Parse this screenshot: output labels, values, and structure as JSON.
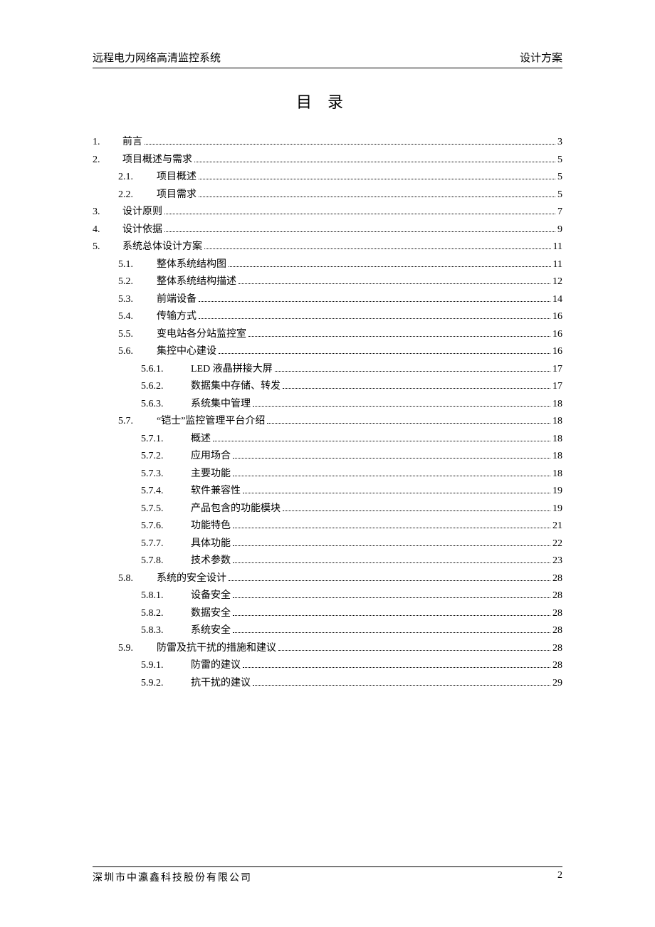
{
  "header": {
    "left": "远程电力网络高清监控系统",
    "right": "设计方案"
  },
  "title": "目录",
  "toc": [
    {
      "lvl": 1,
      "num": "1.",
      "label": "前言",
      "page": "3"
    },
    {
      "lvl": 1,
      "num": "2.",
      "label": "项目概述与需求",
      "page": "5"
    },
    {
      "lvl": 2,
      "num": "2.1.",
      "label": "项目概述",
      "page": "5"
    },
    {
      "lvl": 2,
      "num": "2.2.",
      "label": "项目需求",
      "page": "5"
    },
    {
      "lvl": 1,
      "num": "3.",
      "label": "设计原则",
      "page": "7"
    },
    {
      "lvl": 1,
      "num": "4.",
      "label": "设计依据",
      "page": "9"
    },
    {
      "lvl": 1,
      "num": "5.",
      "label": "系统总体设计方案",
      "page": "11"
    },
    {
      "lvl": 2,
      "num": "5.1.",
      "label": "整体系统结构图",
      "page": "11"
    },
    {
      "lvl": 2,
      "num": "5.2.",
      "label": "整体系统结构描述",
      "page": "12"
    },
    {
      "lvl": 2,
      "num": "5.3.",
      "label": "前端设备",
      "page": "14"
    },
    {
      "lvl": 2,
      "num": "5.4.",
      "label": "传输方式",
      "page": "16"
    },
    {
      "lvl": 2,
      "num": "5.5.",
      "label": "变电站各分站监控室",
      "page": "16"
    },
    {
      "lvl": 2,
      "num": "5.6.",
      "label": "集控中心建设",
      "page": "16"
    },
    {
      "lvl": 3,
      "num": "5.6.1.",
      "label": "LED 液晶拼接大屏",
      "page": "17"
    },
    {
      "lvl": 3,
      "num": "5.6.2.",
      "label": "数据集中存储、转发",
      "page": "17"
    },
    {
      "lvl": 3,
      "num": "5.6.3.",
      "label": "系统集中管理",
      "page": "18"
    },
    {
      "lvl": 2,
      "num": "5.7.",
      "label": "“铠士”监控管理平台介绍",
      "page": "18"
    },
    {
      "lvl": 3,
      "num": "5.7.1.",
      "label": "概述",
      "page": "18"
    },
    {
      "lvl": 3,
      "num": "5.7.2.",
      "label": "应用场合",
      "page": "18"
    },
    {
      "lvl": 3,
      "num": "5.7.3.",
      "label": "主要功能",
      "page": "18"
    },
    {
      "lvl": 3,
      "num": "5.7.4.",
      "label": "软件兼容性",
      "page": "19"
    },
    {
      "lvl": 3,
      "num": "5.7.5.",
      "label": "产品包含的功能模块",
      "page": "19"
    },
    {
      "lvl": 3,
      "num": "5.7.6.",
      "label": "功能特色",
      "page": "21"
    },
    {
      "lvl": 3,
      "num": "5.7.7.",
      "label": "具体功能",
      "page": "22"
    },
    {
      "lvl": 3,
      "num": "5.7.8.",
      "label": "技术参数",
      "page": "23"
    },
    {
      "lvl": 2,
      "num": "5.8.",
      "label": "系统的安全设计",
      "page": "28"
    },
    {
      "lvl": 3,
      "num": "5.8.1.",
      "label": "设备安全",
      "page": "28"
    },
    {
      "lvl": 3,
      "num": "5.8.2.",
      "label": "数据安全",
      "page": "28"
    },
    {
      "lvl": 3,
      "num": "5.8.3.",
      "label": "系统安全",
      "page": "28"
    },
    {
      "lvl": 2,
      "num": "5.9.",
      "label": "防雷及抗干扰的措施和建议",
      "page": "28"
    },
    {
      "lvl": 3,
      "num": "5.9.1.",
      "label": "防雷的建议",
      "page": "28"
    },
    {
      "lvl": 3,
      "num": "5.9.2.",
      "label": "抗干扰的建议",
      "page": "29"
    }
  ],
  "footer": {
    "company": "深圳市中瀛鑫科技股份有限公司",
    "page": "2"
  }
}
